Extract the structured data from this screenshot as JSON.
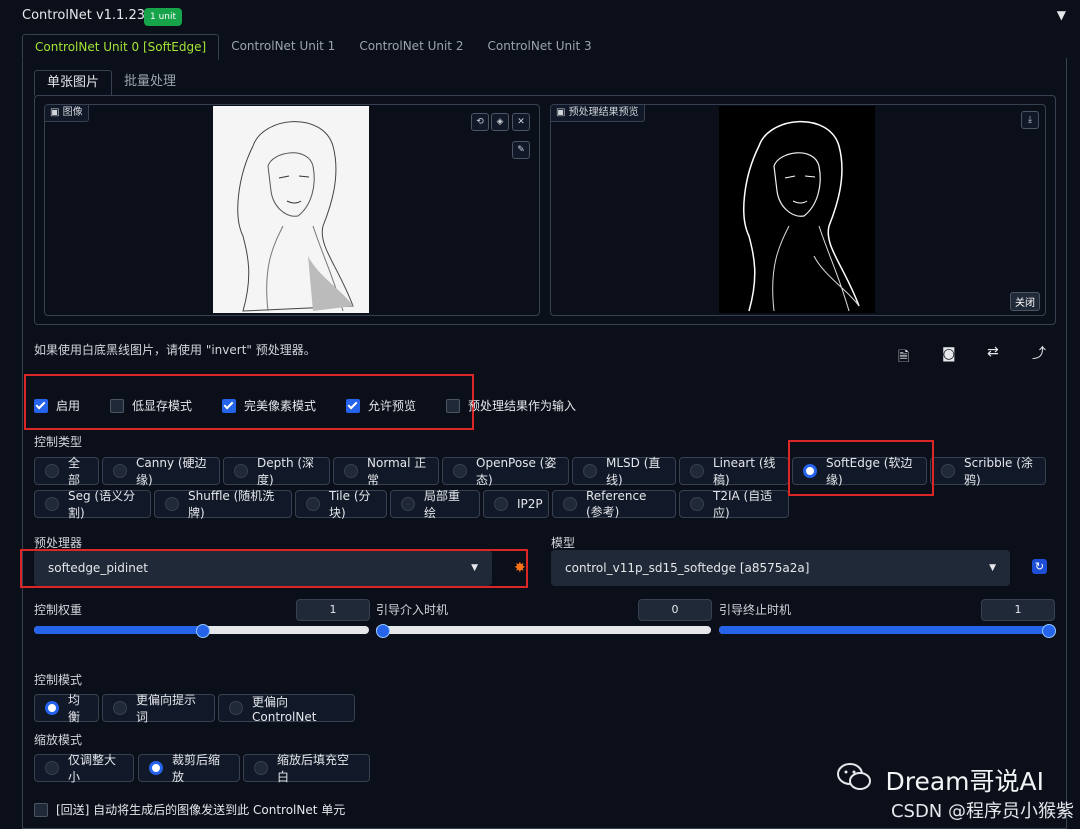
{
  "header": {
    "title": "ControlNet v1.1.238",
    "badge": "1 unit",
    "collapse_icon": "▼"
  },
  "unit_tabs": [
    "ControlNet Unit 0 [SoftEdge]",
    "ControlNet Unit 1",
    "ControlNet Unit 2",
    "ControlNet Unit 3"
  ],
  "sub_tabs": [
    "单张图片",
    "批量处理"
  ],
  "image_panel": {
    "label": "图像"
  },
  "preview_panel": {
    "label": "预处理结果预览",
    "close_label": "关闭"
  },
  "hint": "如果使用白底黑线图片，请使用 \"invert\" 预处理器。",
  "checkboxes": [
    {
      "label": "启用",
      "checked": true
    },
    {
      "label": "低显存模式",
      "checked": false
    },
    {
      "label": "完美像素模式",
      "checked": true
    },
    {
      "label": "允许预览",
      "checked": true
    },
    {
      "label": "预处理结果作为输入",
      "checked": false
    }
  ],
  "control_type": {
    "label": "控制类型",
    "options": [
      "全部",
      "Canny (硬边缘)",
      "Depth (深度)",
      "Normal 正常",
      "OpenPose (姿态)",
      "MLSD (直线)",
      "Lineart (线稿)",
      "SoftEdge (软边缘)",
      "Scribble (涂鸦)",
      "Seg (语义分割)",
      "Shuffle (随机洗牌)",
      "Tile (分块)",
      "局部重绘",
      "IP2P",
      "Reference (参考)",
      "T2IA (自适应)"
    ],
    "selected": "SoftEdge (软边缘)"
  },
  "preprocessor": {
    "label": "预处理器",
    "value": "softedge_pidinet"
  },
  "model": {
    "label": "模型",
    "value": "control_v11p_sd15_softedge [a8575a2a]"
  },
  "sliders": [
    {
      "label": "控制权重",
      "value": "1",
      "fraction": 0.5
    },
    {
      "label": "引导介入时机",
      "value": "0",
      "fraction": 0.0
    },
    {
      "label": "引导终止时机",
      "value": "1",
      "fraction": 1.0
    }
  ],
  "control_mode": {
    "label": "控制模式",
    "options": [
      "均衡",
      "更偏向提示词",
      "更偏向 ControlNet"
    ],
    "selected": "均衡"
  },
  "resize_mode": {
    "label": "缩放模式",
    "options": [
      "仅调整大小",
      "裁剪后缩放",
      "缩放后填充空白"
    ],
    "selected": "裁剪后缩放"
  },
  "loopback": {
    "label": "[回送] 自动将生成后的图像发送到此 ControlNet 单元",
    "checked": false
  },
  "watermark": {
    "line1": "Dream哥说AI",
    "line2": "CSDN @程序员小猴紫"
  },
  "colors": {
    "accent": "#2563eb",
    "active_tab": "#a3e635",
    "highlight": "#dc2626",
    "background": "#0b0f19"
  }
}
